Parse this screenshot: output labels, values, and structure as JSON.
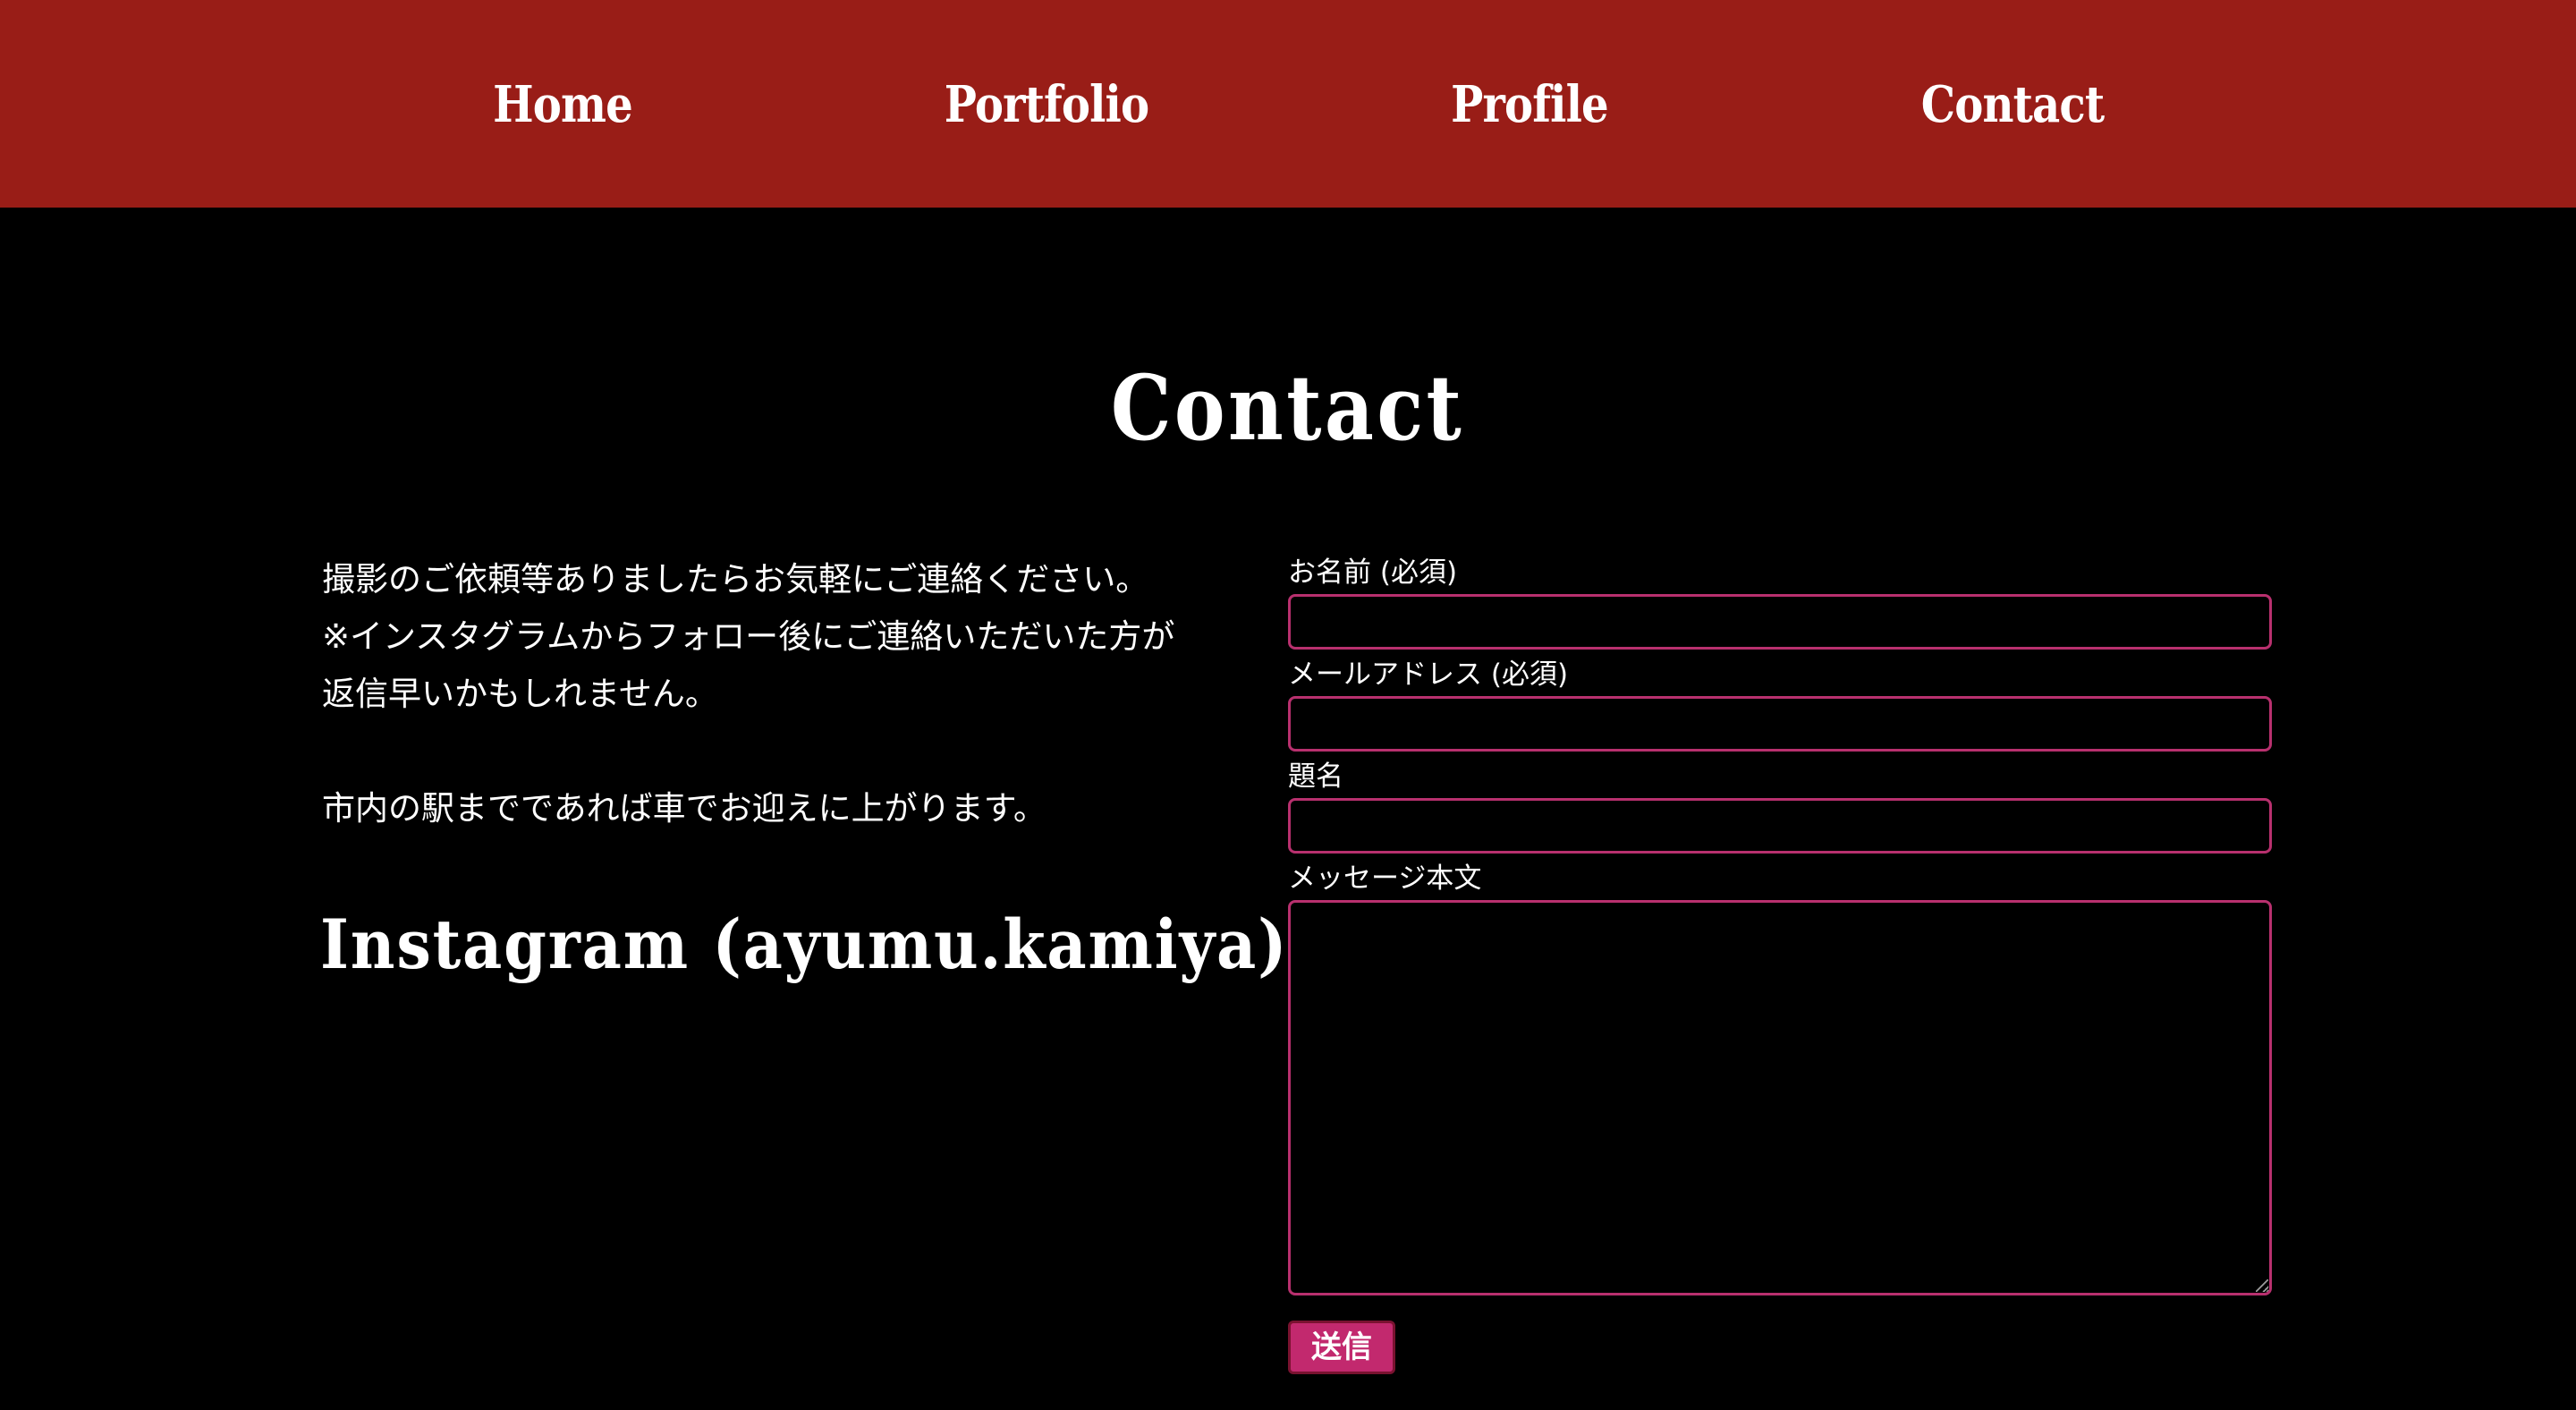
{
  "nav": {
    "items": [
      {
        "label": "Home"
      },
      {
        "label": "Portfolio"
      },
      {
        "label": "Profile"
      },
      {
        "label": "Contact"
      }
    ]
  },
  "page": {
    "title": "Contact"
  },
  "intro": {
    "lines": [
      "撮影のご依頼等ありましたらお気軽にご連絡ください。",
      "※インスタグラムからフォロー後にご連絡いただいた方が",
      "返信早いかもしれません。",
      "市内の駅までであれば車でお迎えに上がります。"
    ]
  },
  "instagram": {
    "label": "Instagram (ayumu.kamiya)"
  },
  "form": {
    "name_label": "お名前 (必須)",
    "name_value": "",
    "email_label": "メールアドレス (必須)",
    "email_value": "",
    "subject_label": "題名",
    "subject_value": "",
    "message_label": "メッセージ本文",
    "message_value": "",
    "submit_label": "送信"
  },
  "colors": {
    "nav_background": "#991d17",
    "page_background": "#000000",
    "input_border": "#b8306e",
    "submit_background": "#c2296e"
  }
}
